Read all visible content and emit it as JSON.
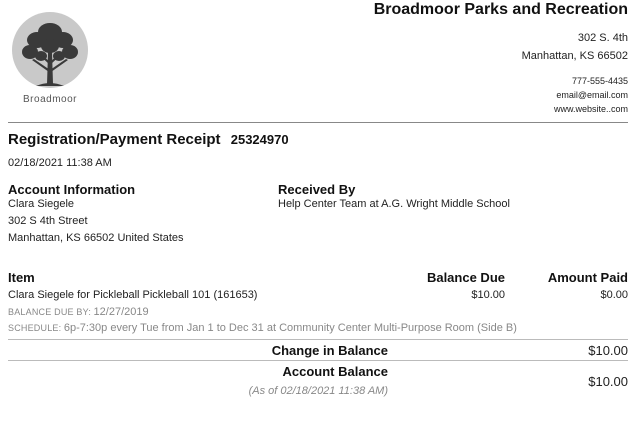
{
  "organization": {
    "name": "Broadmoor Parks and Recreation",
    "logo_text": "Broadmoor",
    "address_line1": "302 S. 4th",
    "address_line2": "Manhattan, KS 66502",
    "phone": "777-555-4435",
    "email": "email@email.com",
    "website": "www.website..com"
  },
  "receipt": {
    "title": "Registration/Payment Receipt",
    "number": "25324970",
    "datetime": "02/18/2021 11:38 AM"
  },
  "account": {
    "heading": "Account Information",
    "name": "Clara Siegele",
    "street": "302 S 4th Street",
    "city_line": "Manhattan, KS 66502 United States"
  },
  "received_by": {
    "heading": "Received By",
    "value": "Help Center Team at A.G. Wright Middle School"
  },
  "items": {
    "col_item": "Item",
    "col_balance_due": "Balance Due",
    "col_amount_paid": "Amount Paid",
    "rows": [
      {
        "description": "Clara Siegele for Pickleball Pickleball 101 (161653)",
        "balance_due": "$10.00",
        "amount_paid": "$0.00",
        "due_label": "BALANCE DUE BY:",
        "due_value": "12/27/2019",
        "schedule_label": "SCHEDULE:",
        "schedule_value": "6p-7:30p every Tue from Jan 1 to Dec 31 at Community Center Multi-Purpose Room (Side B)"
      }
    ]
  },
  "summary": {
    "change_label": "Change in Balance",
    "change_value": "$10.00",
    "account_balance_label": "Account Balance",
    "account_balance_value": "$10.00",
    "as_of": "(As of 02/18/2021 11:38 AM)"
  }
}
